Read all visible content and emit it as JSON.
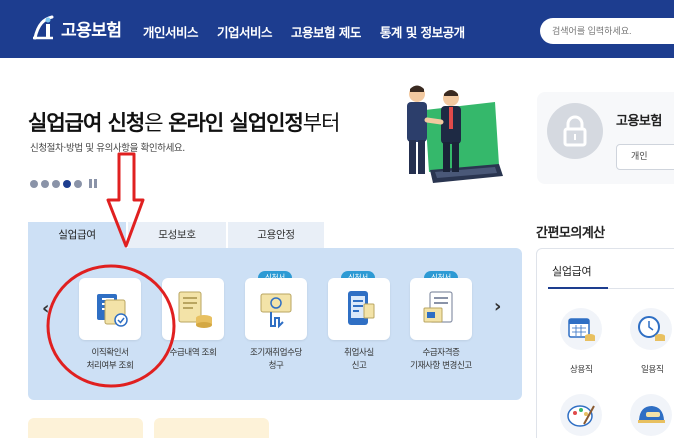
{
  "header": {
    "logo_text": "고용보험",
    "nav": [
      "개인서비스",
      "기업서비스",
      "고용보험 제도",
      "통계 및 정보공개"
    ],
    "search_placeholder": "검색어를 입력하세요."
  },
  "hero": {
    "title_parts": [
      {
        "text": "실업급여 신청",
        "bold": true
      },
      {
        "text": "은 ",
        "bold": false
      },
      {
        "text": "온라인 실업인정",
        "bold": true
      },
      {
        "text": "부터",
        "bold": false
      }
    ],
    "subtitle": "신청절차·방법 및 유의사항을 확인하세요.",
    "slide_count": 5,
    "active_slide": 4
  },
  "login_card": {
    "title": "고용보험 ",
    "button": "개인"
  },
  "service_tabs": {
    "tabs": [
      "실업급여",
      "모성보호",
      "고용안정"
    ],
    "active": 0,
    "items": [
      {
        "label_lines": [
          "이직확인서",
          "처리여부 조회"
        ],
        "badge": "",
        "icon": "document-check-icon"
      },
      {
        "label_lines": [
          "수급내역 조회"
        ],
        "badge": "",
        "icon": "receipt-coins-icon"
      },
      {
        "label_lines": [
          "조기재취업수당",
          "청구"
        ],
        "badge": "신청서",
        "icon": "hand-money-icon"
      },
      {
        "label_lines": [
          "취업사실",
          "신고"
        ],
        "badge": "신청서",
        "icon": "mobile-document-icon"
      },
      {
        "label_lines": [
          "수급자격증",
          "기재사항 변경신고"
        ],
        "badge": "신청서",
        "icon": "document-edit-icon"
      }
    ]
  },
  "calculator": {
    "title": "간편모의계산",
    "tab": "실업급여",
    "items": [
      {
        "label": "상용직",
        "icon": "calendar-coins-icon"
      },
      {
        "label": "일용직",
        "icon": "clock-coins-icon"
      },
      {
        "label": "",
        "icon": "palette-icon"
      },
      {
        "label": "",
        "icon": "helmet-icon"
      }
    ]
  },
  "colors": {
    "header_bg": "#1d3d8f",
    "tab_panel_bg": "#cde0f5",
    "badge_bg": "#2d9ad4",
    "annotation_red": "#e02020"
  }
}
